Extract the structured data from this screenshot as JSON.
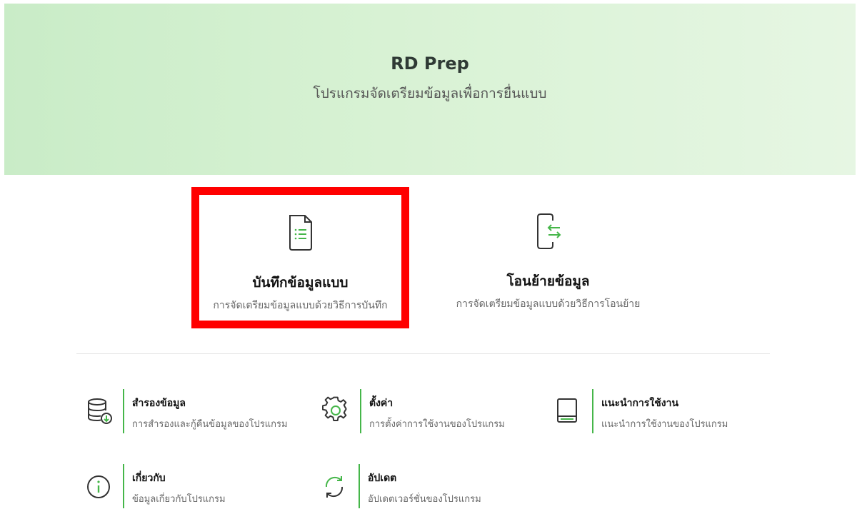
{
  "header": {
    "title": "RD Prep",
    "subtitle": "โปรแกรมจัดเตรียมข้อมูลเพื่อการยื่นแบบ"
  },
  "cards": [
    {
      "icon": "document-list-icon",
      "title": "บันทึกข้อมูลแบบ",
      "description": "การจัดเตรียมข้อมูลแบบด้วยวิธีการบันทึก",
      "highlighted": true
    },
    {
      "icon": "transfer-icon",
      "title": "โอนย้ายข้อมูล",
      "description": "การจัดเตรียมข้อมูลแบบด้วยวิธีการโอนย้าย",
      "highlighted": false
    }
  ],
  "tools": [
    {
      "icon": "database-download-icon",
      "title": "สำรองข้อมูล",
      "description": "การสำรองและกู้คืนข้อมูลของโปรแกรม"
    },
    {
      "icon": "gear-icon",
      "title": "ตั้งค่า",
      "description": "การตั้งค่าการใช้งานของโปรแกรม"
    },
    {
      "icon": "book-icon",
      "title": "แนะนำการใช้งาน",
      "description": "แนะนำการใช้งานของโปรแกรม"
    },
    {
      "icon": "info-icon",
      "title": "เกี่ยวกับ",
      "description": "ข้อมูลเกี่ยวกับโปรแกรม"
    },
    {
      "icon": "refresh-icon",
      "title": "อัปเดต",
      "description": "อัปเดตเวอร์ชั่นของโปรแกรม"
    }
  ],
  "colors": {
    "accent": "#45b649",
    "highlight_border": "#ff0000",
    "icon_stroke": "#333333"
  }
}
